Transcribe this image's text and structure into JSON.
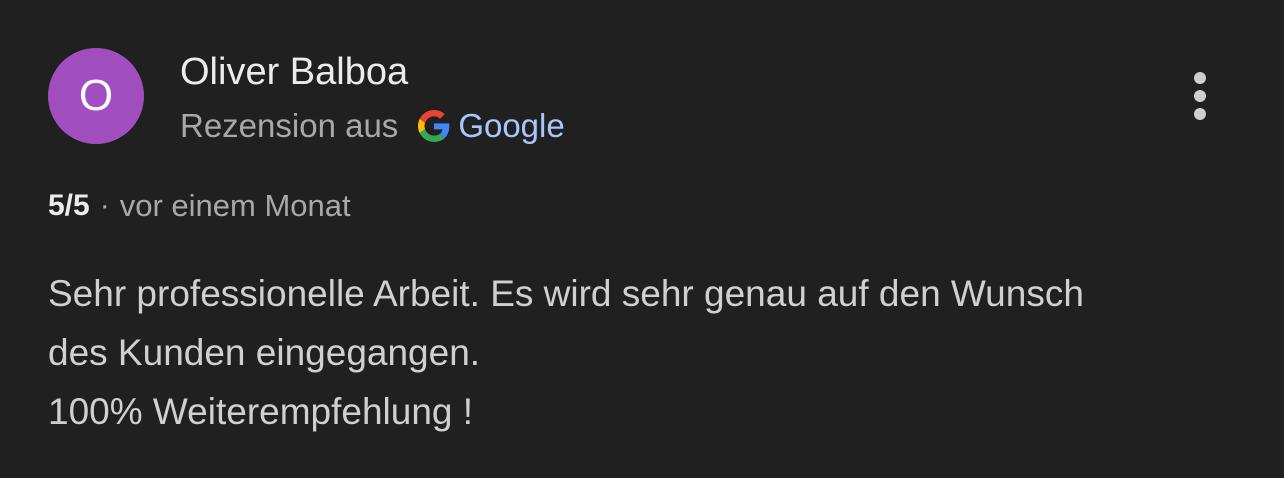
{
  "review": {
    "author": {
      "initial": "O",
      "name": "Oliver Balboa",
      "avatar_color": "#a04ec0"
    },
    "source": {
      "prefix": "Rezension aus",
      "icon": "google-g-icon",
      "name": "Google",
      "link_color": "#a8c7fa"
    },
    "menu_icon": "more-vert-icon",
    "rating": "5/5",
    "separator": "·",
    "time": "vor einem Monat",
    "text_lines": [
      "Sehr professionelle Arbeit. Es wird sehr genau auf den Wunsch",
      "des Kunden eingegangen.",
      "100% Weiterempfehlung !"
    ]
  }
}
